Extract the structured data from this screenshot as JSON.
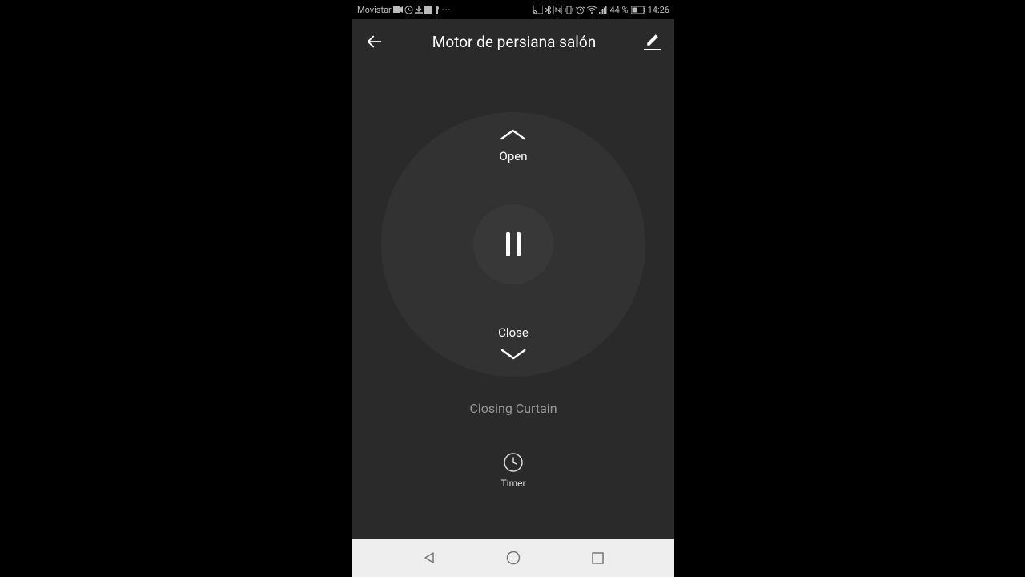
{
  "status_bar": {
    "carrier": "Movistar",
    "battery": "44 %",
    "time": "14:26"
  },
  "header": {
    "title": "Motor de persiana salón"
  },
  "controls": {
    "open_label": "Open",
    "close_label": "Close"
  },
  "status_text": "Closing Curtain",
  "timer_label": "Timer"
}
